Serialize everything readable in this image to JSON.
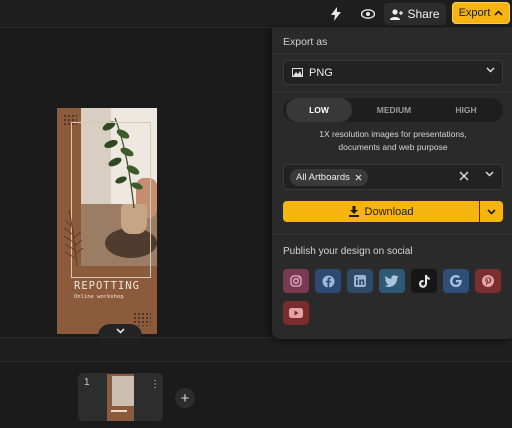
{
  "toolbar": {
    "share_label": "Share",
    "export_label": "Export",
    "icons": [
      "lightning-icon",
      "eye-icon",
      "user-plus-icon",
      "chevron-up-icon"
    ]
  },
  "artboard": {
    "title": "REPOTTING",
    "subtitle": "Online workshop"
  },
  "pages": {
    "items": [
      {
        "number": "1"
      }
    ],
    "add_icon": "plus-icon"
  },
  "export_panel": {
    "heading": "Export as",
    "format": {
      "value": "PNG",
      "icon": "image-icon"
    },
    "resolution": {
      "options": [
        "LOW",
        "MEDIUM",
        "HIGH"
      ],
      "selected": "LOW"
    },
    "description_line1": "1X resolution images for presentations,",
    "description_line2": "documents and web purpose",
    "artboards": {
      "chip": "All Artboards"
    },
    "download_label": "Download",
    "social_heading": "Publish your design on social",
    "social": [
      {
        "name": "instagram",
        "color": "#7a3a52"
      },
      {
        "name": "facebook",
        "color": "#2e4a73"
      },
      {
        "name": "linkedin",
        "color": "#2f4a68"
      },
      {
        "name": "twitter",
        "color": "#2f5874"
      },
      {
        "name": "tiktok",
        "color": "#161616"
      },
      {
        "name": "google",
        "color": "#2f4f78"
      },
      {
        "name": "pinterest",
        "color": "#7a2e30"
      },
      {
        "name": "youtube",
        "color": "#7a2b2b"
      }
    ]
  },
  "colors": {
    "accent": "#f6b40f",
    "panel": "#2a2a2a"
  }
}
